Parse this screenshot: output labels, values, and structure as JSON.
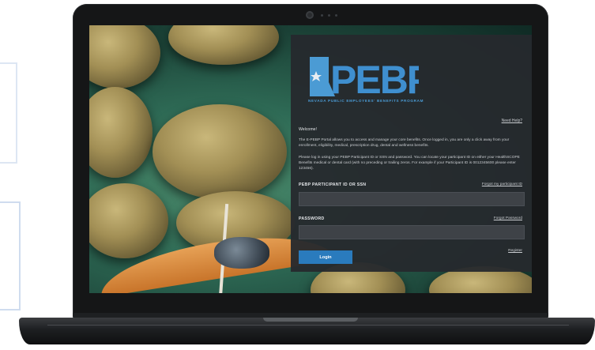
{
  "logo": {
    "text": "PEBP",
    "tagline": "NEVADA PUBLIC EMPLOYEES' BENEFITS PROGRAM",
    "colors": {
      "state": "#4b9bd4",
      "letters": "#3f8fcf"
    }
  },
  "panel": {
    "need_help": "Need Help?",
    "welcome": "Welcome!",
    "intro": "The E-PEBP Portal allows you to access and manage your core benefits. Once logged in, you are only a click away from your enrollment, eligibility, medical, prescription drug, dental and wellness benefits.",
    "instructions": "Please log in using your PEBP Participant ID or SSN and password. You can locate your participant ID on either your HealthSCOPE Benefits medical or dental card (with no preceding or trailing zeros. For example if your Participant ID is 0012345600 please enter 123456).",
    "participant_label": "PEBP PARTICIPANT ID OR SSN",
    "forgot_id": "Forgot my participant ID",
    "participant_value": "",
    "password_label": "PASSWORD",
    "forgot_password": "Forgot Password",
    "password_value": "",
    "login_button": "Login",
    "register": "Register"
  },
  "icons": {
    "camera": "webcam-icon",
    "state_shape": "nevada-state-icon",
    "star": "star-icon"
  },
  "colors": {
    "accent": "#2a7bbd",
    "panel": "#26292d",
    "frame": "#151617"
  }
}
